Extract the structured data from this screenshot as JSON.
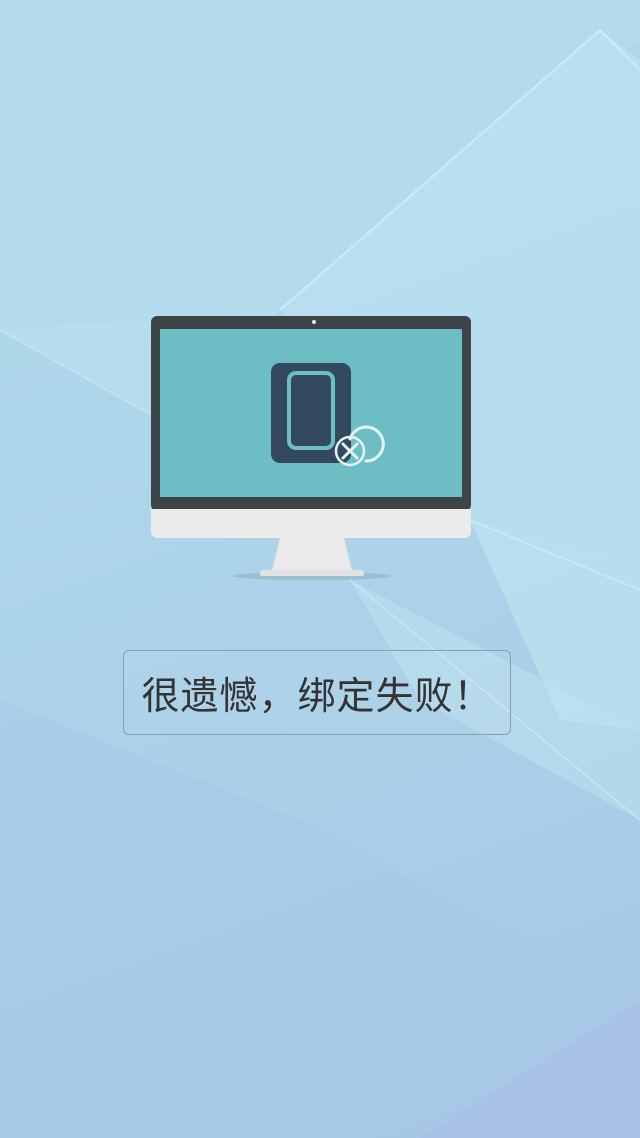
{
  "message": {
    "text": "很遗憾，绑定失败！"
  },
  "illustration": {
    "monitor_icon": "monitor-icon",
    "device_icon": "phone-icon",
    "status_icon": "close-circle-icon"
  },
  "colors": {
    "background": "#aed6ea",
    "monitor_bezel": "#3d4448",
    "monitor_screen": "#6dbec4",
    "monitor_chin": "#ebebeb",
    "phone_body": "#34495e",
    "phone_screen": "#6dbec4",
    "message_text": "#333333",
    "message_border": "#8a9fae"
  }
}
